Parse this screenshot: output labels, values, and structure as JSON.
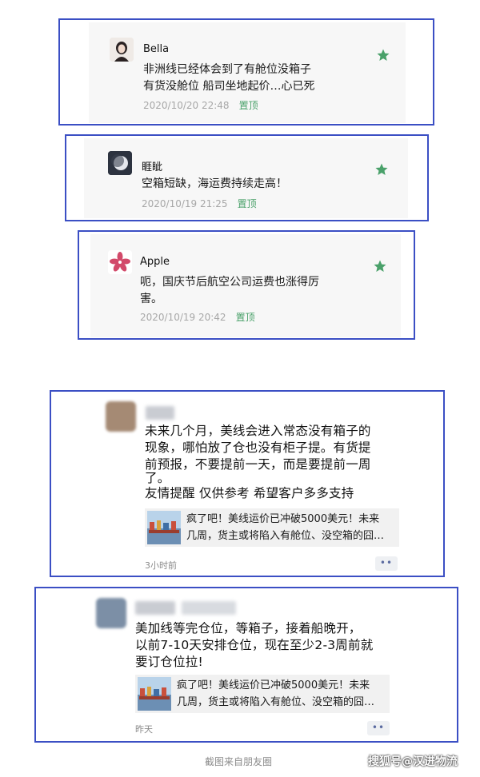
{
  "posts_top": [
    {
      "name": "Bella",
      "line1": "非洲线已经体会到了有舱位没箱子",
      "line2": "有货没舱位 船司坐地起价…心已死",
      "time": "2020/10/20 22:48",
      "pin": "置顶"
    },
    {
      "name": "睚眦",
      "line1": "空箱短缺，海运费持续走高！",
      "time": "2020/10/19 21:25",
      "pin": "置顶"
    },
    {
      "name": "Apple",
      "line1": "呃，国庆节后航空公司运费也涨得厉",
      "line2": "害。",
      "time": "2020/10/19 20:42",
      "pin": "置顶"
    }
  ],
  "moments": [
    {
      "text_lines": [
        "未来几个月，美线会进入常态没有箱子的",
        "现象，哪怕放了仓也没有柜子提。有货提",
        "前预报，不要提前一天，而是要提前一周",
        "了。",
        "友情提醒 仅供参考 希望客户多多支持"
      ],
      "card_line1": "疯了吧！美线运价已冲破5000美元！未来",
      "card_line2": "几周，货主或将陷入有舱位、没空箱的囧…",
      "time": "3小时前",
      "more": "••"
    },
    {
      "text_lines": [
        "美加线等完仓位，等箱子，接着船晚开，",
        "以前7-10天安排仓位，现在至少2-3周前就",
        "要订仓位拉!"
      ],
      "card_line1": "疯了吧！美线运价已冲破5000美元！未来",
      "card_line2": "几周，货主或将陷入有舱位、没空箱的囧…",
      "time": "昨天",
      "more": "••"
    }
  ],
  "caption": "截图来自朋友圈",
  "watermark": "搜狐号@汉进物流",
  "colors": {
    "frame": "#3b4fc4",
    "pin": "#4aa16a",
    "star": "#4aa16a"
  }
}
